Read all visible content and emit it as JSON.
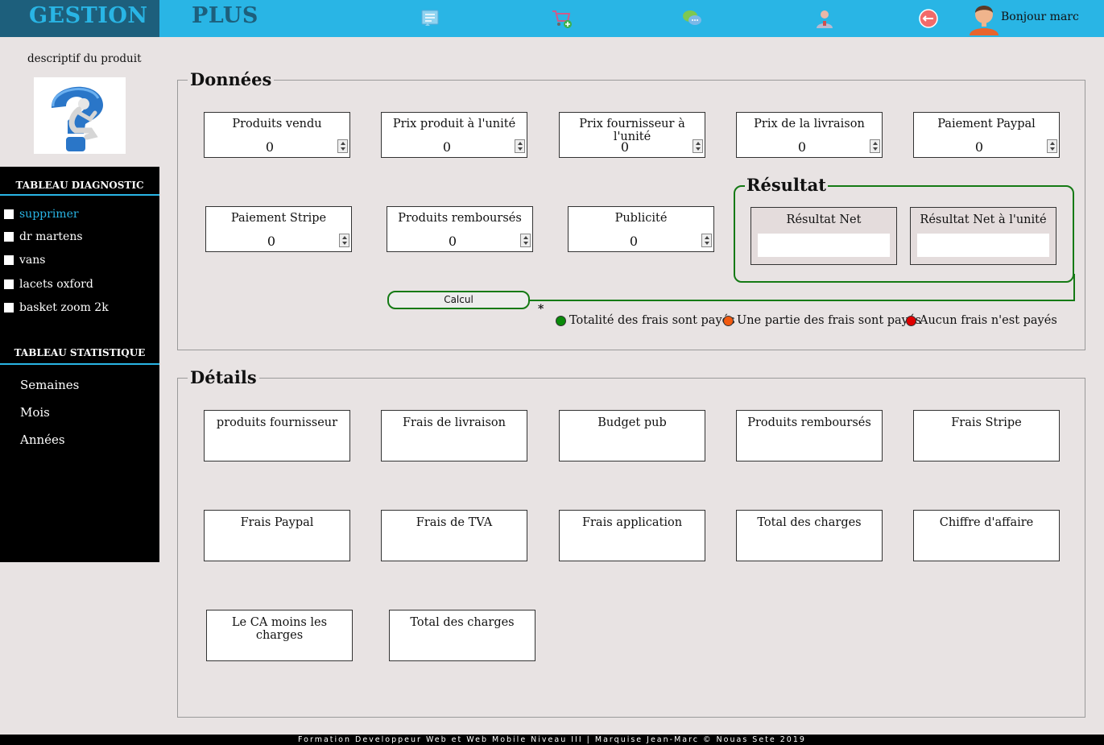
{
  "header": {
    "brand_left": "GESTION",
    "brand_right": "PLUS",
    "greeting": "Bonjour marc",
    "icons": [
      "list-icon",
      "cart-add-icon",
      "chat-icon",
      "user-icon",
      "logout-icon"
    ]
  },
  "sidebar": {
    "description": "descriptif du produit",
    "diag_heading": "TABLEAU DIAGNOSTIC",
    "items": [
      {
        "label": "supprimer",
        "color": "#29b5e5"
      },
      {
        "label": "dr martens"
      },
      {
        "label": "vans"
      },
      {
        "label": "lacets oxford"
      },
      {
        "label": "basket zoom 2k"
      }
    ],
    "stat_heading": "TABLEAU STATISTIQUE",
    "stats": [
      "Semaines",
      "Mois",
      "Années"
    ]
  },
  "donnees": {
    "legend": "Données",
    "fields": [
      {
        "label": "Produits vendu",
        "value": "0"
      },
      {
        "label": "Prix produit à l'unité",
        "value": "0"
      },
      {
        "label": "Prix fournisseur à l'unité",
        "value": "0"
      },
      {
        "label": "Prix de la livraison",
        "value": "0"
      },
      {
        "label": "Paiement Paypal",
        "value": "0"
      },
      {
        "label": "Paiement Stripe",
        "value": "0"
      },
      {
        "label": "Produits remboursés",
        "value": "0"
      },
      {
        "label": "Publicité",
        "value": "0"
      }
    ],
    "resultat": {
      "legend": "Résultat",
      "net_label": "Résultat Net",
      "net_unit_label": "Résultat Net à l'unité"
    },
    "calc_button": "Calcul",
    "asterisk": "*",
    "status_legend": [
      {
        "label": "Totalité des frais sont payés",
        "color": "#0a8a0a"
      },
      {
        "label": "Une partie des frais sont payés",
        "color": "#f25a10"
      },
      {
        "label": "Aucun frais n'est payés",
        "color": "#e00000"
      }
    ]
  },
  "details": {
    "legend": "Détails",
    "boxes": [
      "produits fournisseur",
      "Frais de livraison",
      "Budget pub",
      "Produits remboursés",
      "Frais Stripe",
      "Frais Paypal",
      "Frais de TVA",
      "Frais application",
      "Total des charges",
      "Chiffre d'affaire",
      "Le CA moins les charges",
      "Total des charges"
    ]
  },
  "footer": "Formation Developpeur Web et Web Mobile Niveau III | Marquise Jean-Marc © Nouas Sete 2019"
}
